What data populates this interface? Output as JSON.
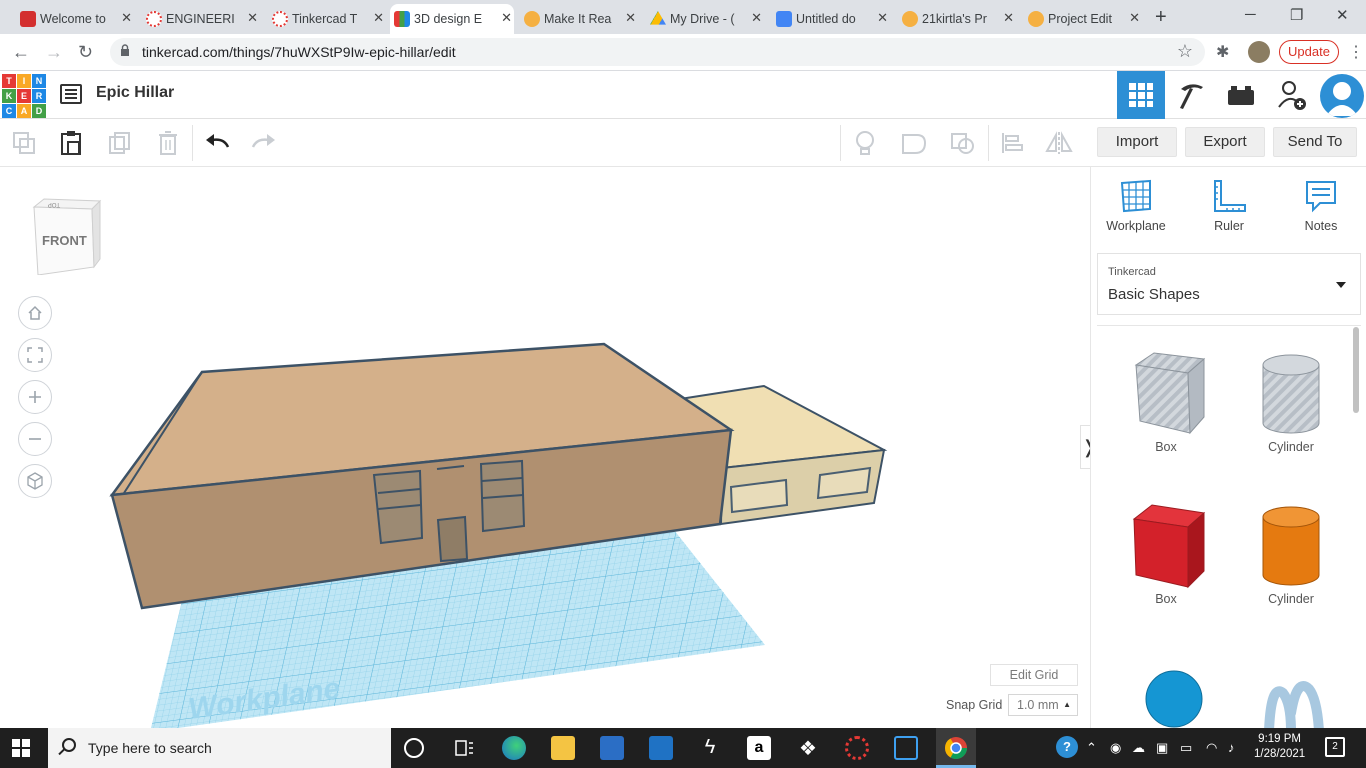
{
  "browser": {
    "tabs": [
      {
        "label": "Welcome to",
        "favicon_color": "#d32f2f"
      },
      {
        "label": "ENGINEERIN",
        "favicon_color": "#e53935"
      },
      {
        "label": "Tinkercad T",
        "favicon_color": "#e53935"
      },
      {
        "label": "3D design E",
        "favicon_color": "#4caf50"
      },
      {
        "label": "Make It Rea",
        "favicon_color": "#f5b042"
      },
      {
        "label": "My Drive - (",
        "favicon_color": "#fbbc04"
      },
      {
        "label": "Untitled do",
        "favicon_color": "#4285f4"
      },
      {
        "label": "21kirtla's Pr",
        "favicon_color": "#f5b042"
      },
      {
        "label": "Project Edit",
        "favicon_color": "#f5b042"
      }
    ],
    "new_tab_symbol": "+",
    "url": "tinkercad.com/things/7huWXStP9Iw-epic-hillar/edit",
    "update_label": "Update"
  },
  "header": {
    "logo_letters": [
      "T",
      "I",
      "N",
      "K",
      "E",
      "R",
      "C",
      "A",
      "D"
    ],
    "design_title": "Epic Hillar"
  },
  "toolbar": {
    "import_label": "Import",
    "export_label": "Export",
    "sendto_label": "Send To"
  },
  "viewcube": {
    "face_label": "FRONT",
    "top_label": "TOP"
  },
  "canvas": {
    "workplane_watermark": "Workplane",
    "edit_grid_label": "Edit Grid",
    "snap_grid_label": "Snap Grid",
    "snap_grid_value": "1.0 mm"
  },
  "panel": {
    "tools": [
      {
        "label": "Workplane",
        "icon": "workplane-icon"
      },
      {
        "label": "Ruler",
        "icon": "ruler-icon"
      },
      {
        "label": "Notes",
        "icon": "notes-icon"
      }
    ],
    "library_small": "Tinkercad",
    "library_name": "Basic Shapes",
    "shapes": [
      {
        "label": "Box",
        "color": "#9fa6ae"
      },
      {
        "label": "Cylinder",
        "color": "#a9b0b8"
      },
      {
        "label": "Box",
        "color": "#d3212a"
      },
      {
        "label": "Cylinder",
        "color": "#e57a10"
      }
    ]
  },
  "taskbar": {
    "search_placeholder": "Type here to search",
    "time": "9:19 PM",
    "date": "1/28/2021",
    "notification_count": "2"
  },
  "colors": {
    "accent": "#2d8fd5",
    "building_top": "#d4b08a",
    "building_front": "#b09070",
    "annex_top": "#f0dfb3",
    "workplane": "#8fd3ec"
  }
}
